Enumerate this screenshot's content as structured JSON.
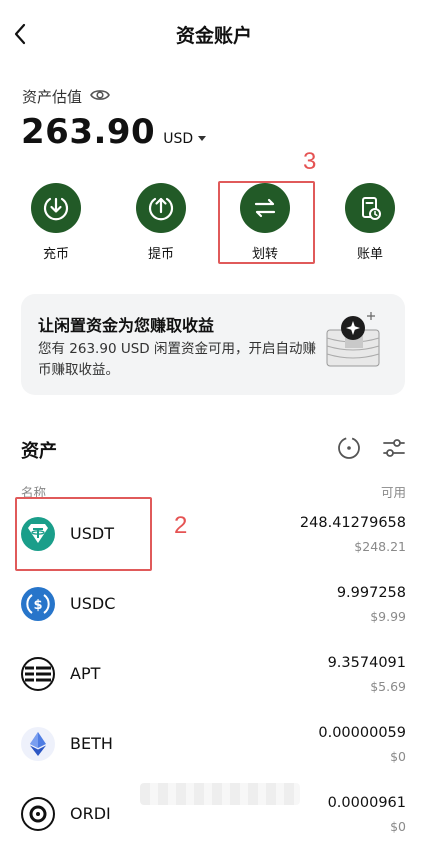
{
  "header": {
    "title": "资金账户"
  },
  "summary": {
    "label": "资产估值",
    "balance": "263.90",
    "currency": "USD"
  },
  "actions": [
    {
      "label": "充币",
      "icon": "deposit-icon"
    },
    {
      "label": "提币",
      "icon": "withdraw-icon"
    },
    {
      "label": "划转",
      "icon": "transfer-icon"
    },
    {
      "label": "账单",
      "icon": "bill-icon"
    }
  ],
  "annotations": {
    "transfer_number": "3",
    "usdt_number": "2",
    "color": "#e05a5a"
  },
  "promo": {
    "title": "让闲置资金为您赚取收益",
    "description": "您有 263.90 USD 闲置资金可用，开启自动赚币赚取收益。"
  },
  "assets": {
    "title": "资产",
    "col_name": "名称",
    "col_available": "可用",
    "items": [
      {
        "symbol": "USDT",
        "amount": "248.41279658",
        "usd": "$248.21",
        "icon": "usdt-icon"
      },
      {
        "symbol": "USDC",
        "amount": "9.997258",
        "usd": "$9.99",
        "icon": "usdc-icon"
      },
      {
        "symbol": "APT",
        "amount": "9.3574091",
        "usd": "$5.69",
        "icon": "apt-icon"
      },
      {
        "symbol": "BETH",
        "amount": "0.00000059",
        "usd": "$0",
        "icon": "beth-icon"
      },
      {
        "symbol": "ORDI",
        "amount": "0.0000961",
        "usd": "$0",
        "icon": "ordi-icon"
      }
    ]
  },
  "colors": {
    "action_green": "#225a27",
    "usdt_teal": "#1a9e8a",
    "usdc_blue": "#2775ca"
  }
}
